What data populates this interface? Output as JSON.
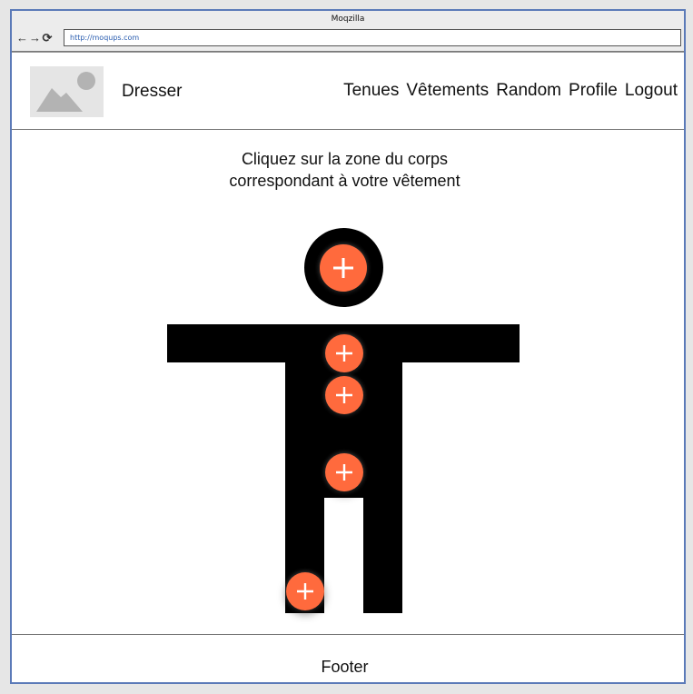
{
  "browser": {
    "window_title": "Moqzilla",
    "url": "http://moqups.com",
    "back_icon": "arrow-left-icon",
    "forward_icon": "arrow-right-icon",
    "reload_icon": "reload-icon"
  },
  "header": {
    "logo_icon": "image-placeholder-icon",
    "brand": "Dresser",
    "nav": {
      "tenues": "Tenues",
      "vetements": "Vêtements",
      "random": "Random",
      "profile": "Profile",
      "logout": "Logout"
    }
  },
  "main": {
    "instruction_line1": "Cliquez sur la zone du corps",
    "instruction_line2": "correspondant à votre vêtement",
    "add_icon": "plus-icon",
    "colors": {
      "accent": "#ff6a3d",
      "silhouette": "#000000"
    }
  },
  "footer": {
    "text": "Footer"
  }
}
